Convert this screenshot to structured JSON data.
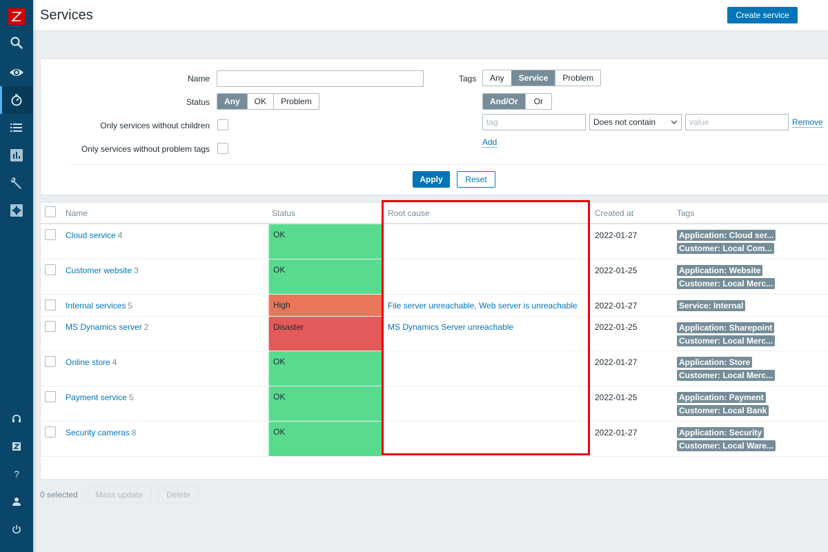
{
  "app": {
    "logo_letter": "Z"
  },
  "sidebar": {
    "items": [
      {
        "icon": "search-icon",
        "active": false
      },
      {
        "icon": "eye-icon",
        "active": false
      },
      {
        "icon": "stopwatch-icon",
        "active": true
      },
      {
        "icon": "list-icon",
        "active": false
      },
      {
        "icon": "chart-icon",
        "active": false
      },
      {
        "icon": "wrench-icon",
        "active": false
      },
      {
        "icon": "gear-icon",
        "active": false
      }
    ],
    "bottom_items": [
      {
        "icon": "headset-icon"
      },
      {
        "icon": "zabbix-share-icon",
        "label": "Z"
      },
      {
        "icon": "help-icon",
        "label": "?"
      },
      {
        "icon": "user-icon"
      },
      {
        "icon": "power-icon"
      }
    ]
  },
  "header": {
    "title": "Services",
    "create_button": "Create service"
  },
  "filter": {
    "name_label": "Name",
    "name_value": "",
    "status_label": "Status",
    "status_options": [
      "Any",
      "OK",
      "Problem"
    ],
    "status_selected": "Any",
    "no_children_label": "Only services without children",
    "no_problem_tags_label": "Only services without problem tags",
    "tags_label": "Tags",
    "tags_options": [
      "Any",
      "Service",
      "Problem"
    ],
    "tags_selected": "Service",
    "logic_options": [
      "And/Or",
      "Or"
    ],
    "logic_selected": "And/Or",
    "tag_placeholder": "tag",
    "operator_value": "Does not contain",
    "value_placeholder": "value",
    "remove_label": "Remove",
    "add_label": "Add",
    "apply_label": "Apply",
    "reset_label": "Reset"
  },
  "table": {
    "columns": [
      "Name",
      "Status",
      "Root cause",
      "Created at",
      "Tags"
    ],
    "rows": [
      {
        "name": "Cloud service",
        "children": "4",
        "status": "OK",
        "status_color": "#59db8f",
        "root_cause": "",
        "created": "2022-01-27",
        "tags": [
          "Application: Cloud ser...",
          "Customer: Local Com..."
        ]
      },
      {
        "name": "Customer website",
        "children": "3",
        "status": "OK",
        "status_color": "#59db8f",
        "root_cause": "",
        "created": "2022-01-25",
        "tags": [
          "Application: Website",
          "Customer: Local Merc..."
        ]
      },
      {
        "name": "Internal services",
        "children": "5",
        "status": "High",
        "status_color": "#e97659",
        "root_cause": "File server unreachable, Web server is unreachable",
        "created": "2022-01-27",
        "tags": [
          "Service: Internal"
        ]
      },
      {
        "name": "MS Dynamics server",
        "children": "2",
        "status": "Disaster",
        "status_color": "#e45959",
        "root_cause": "MS Dynamics Server unreachable",
        "created": "2022-01-25",
        "tags": [
          "Application: Sharepoint",
          "Customer: Local Merc..."
        ]
      },
      {
        "name": "Online store",
        "children": "4",
        "status": "OK",
        "status_color": "#59db8f",
        "root_cause": "",
        "created": "2022-01-27",
        "tags": [
          "Application: Store",
          "Customer: Local Merc..."
        ]
      },
      {
        "name": "Payment service",
        "children": "5",
        "status": "OK",
        "status_color": "#59db8f",
        "root_cause": "",
        "created": "2022-01-25",
        "tags": [
          "Application: Payment",
          "Customer: Local Bank"
        ]
      },
      {
        "name": "Security cameras",
        "children": "8",
        "status": "OK",
        "status_color": "#59db8f",
        "root_cause": "",
        "created": "2022-01-27",
        "tags": [
          "Application: Security",
          "Customer: Local Ware..."
        ]
      }
    ]
  },
  "footer": {
    "selected_text": "0 selected",
    "mass_update_label": "Mass update",
    "delete_label": "Delete"
  }
}
